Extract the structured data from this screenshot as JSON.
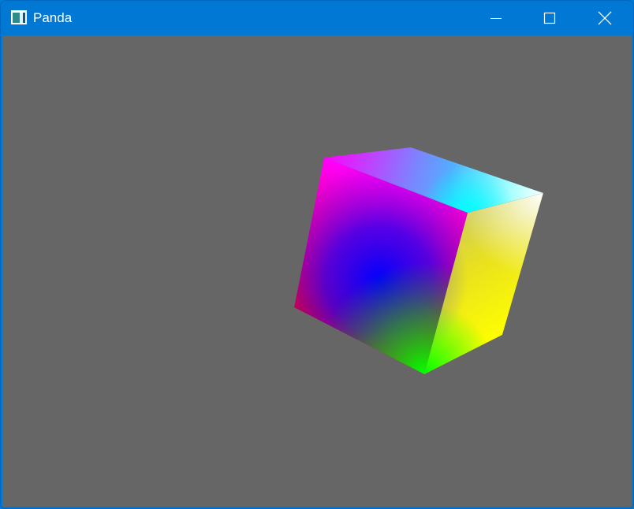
{
  "window": {
    "title": "Panda",
    "app_icon": "window-app-icon",
    "controls": {
      "minimize_icon": "minimize-icon",
      "maximize_icon": "maximize-icon",
      "close_icon": "close-icon"
    }
  },
  "colors": {
    "titlebar": "#0078d4",
    "viewport_background": "#666666",
    "cube_corner_top_left": "#ff00ff",
    "cube_corner_top_back": "#9a9aff",
    "cube_corner_top_right": "#ffffff",
    "cube_corner_top_front": "#00ffff",
    "cube_corner_left": "#ff0000",
    "cube_corner_center": "#0000ff",
    "cube_corner_bottom": "#00ff00",
    "cube_corner_right": "#ffff00"
  }
}
